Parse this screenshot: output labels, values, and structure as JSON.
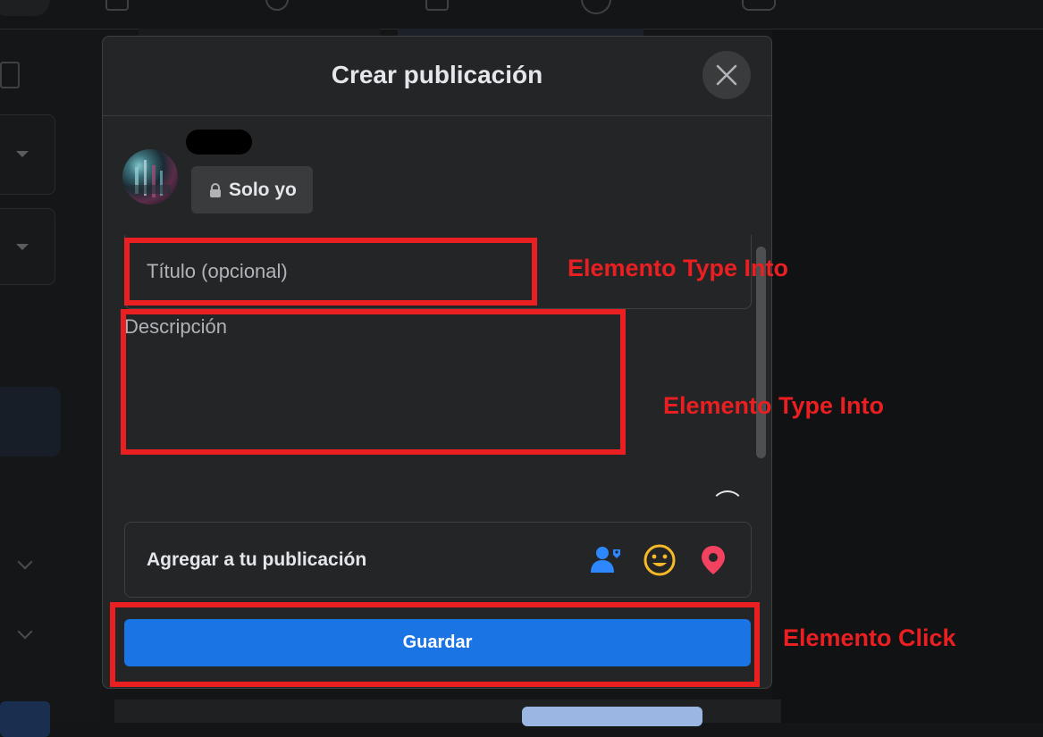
{
  "dialog": {
    "title": "Crear publicación",
    "close_icon": "close-icon",
    "privacy": {
      "label": "Solo yo",
      "icon": "lock-icon"
    },
    "title_field": {
      "placeholder": "Título (opcional)",
      "value": ""
    },
    "description_field": {
      "placeholder": "Descripción",
      "value": ""
    },
    "add_to_post": {
      "label": "Agregar a tu publicación",
      "icons": [
        "tag-people-icon",
        "feeling-emoji-icon",
        "location-pin-icon"
      ]
    },
    "save_label": "Guardar"
  },
  "annotations": [
    {
      "label": "Elemento Type Into"
    },
    {
      "label": "Elemento Type Into"
    },
    {
      "label": "Elemento Click"
    }
  ],
  "colors": {
    "accent": "#1b74e4",
    "annotation": "#ea1f22",
    "tag_icon": "#2d88ff",
    "emoji_icon": "#f7b928",
    "location_icon": "#f3425f"
  }
}
